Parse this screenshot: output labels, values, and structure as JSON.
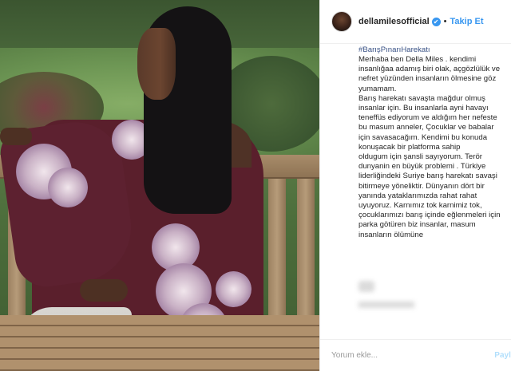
{
  "header": {
    "username": "dellamilesofficial",
    "separator": "•",
    "follow_label": "Takip Et",
    "verified_symbol": "✔"
  },
  "caption": {
    "hashtag": "#BarışPınarıHarekatı",
    "text": "Merhaba ben Della Miles . kendimi insanlığaa adamış biri olak, açgözlülük ve nefret yüzünden insanların ölmesine göz yumamam.\nBarış harekatı savaşta mağdur olmuş insanlar için. Bu insanlarla ayni havayı teneffüs ediyorum ve aldığım her nefeste bu masum anneler, Çocuklar ve babalar için savasacağım. Kendimi bu konuda konuşacak bir platforma sahip\noldugum için şansli sayıyorum. Terör dunyanin en büyük problemi . Türkiye liderliğindeki Suriye barış harekatı savaşi bitirmeye yöneliktir. Dünyanın dört bir yanında yataklarımızda rahat rahat uyuyoruz. Karnımız tok karnimiz tok, çocuklarımızı barış içinde eğlenmeleri için parka götüren biz insanlar, masum insanların ölümüne"
  },
  "comment": {
    "placeholder": "Yorum ekle...",
    "post_label": "Paylaş"
  },
  "colors": {
    "link_blue": "#3897f0",
    "hashtag_blue": "#385185",
    "text": "#262626"
  }
}
